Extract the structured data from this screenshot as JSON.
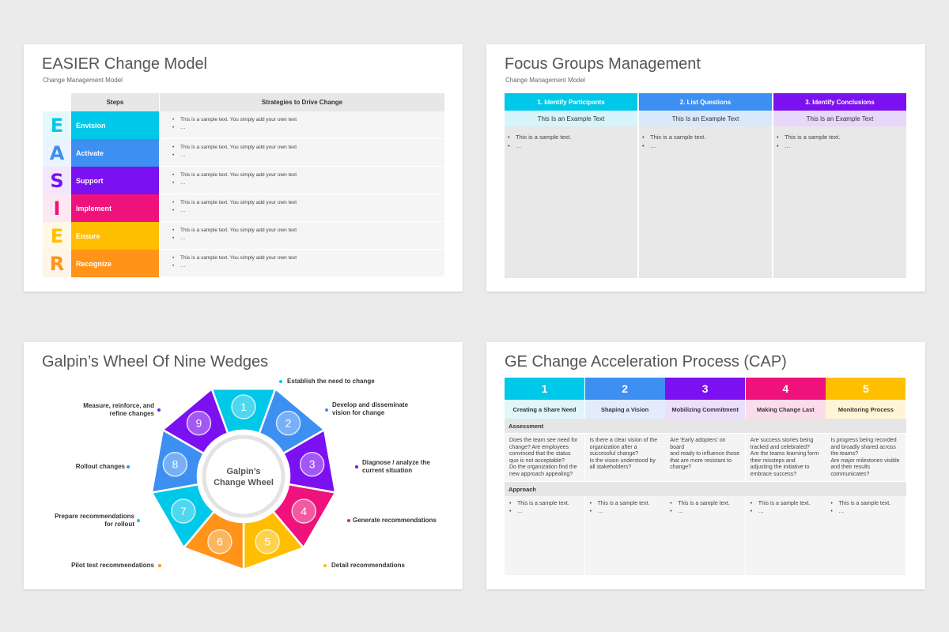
{
  "easier": {
    "title": "EASIER Change Model",
    "subtitle": "Change Management Model",
    "headers": [
      "Steps",
      "Strategies to Drive Change"
    ],
    "rows": [
      {
        "letter": "E",
        "step": "Envision",
        "color": "#00c8e8",
        "b1": "This is a sample text. You simply add your own text",
        "b2": "…"
      },
      {
        "letter": "A",
        "step": "Activate",
        "color": "#3d8ff2",
        "b1": "This is a sample text. You simply add your own text",
        "b2": "…"
      },
      {
        "letter": "S",
        "step": "Support",
        "color": "#7b10f0",
        "b1": "This is a sample text. You simply add your own text",
        "b2": "…"
      },
      {
        "letter": "I",
        "step": "Implement",
        "color": "#f0127c",
        "b1": "This is a sample text. You simply add your own text",
        "b2": "…"
      },
      {
        "letter": "E",
        "step": "Ensure",
        "color": "#ffbf00",
        "b1": "This is a sample text. You simply add your own text",
        "b2": "…"
      },
      {
        "letter": "R",
        "step": "Recognize",
        "color": "#ff9419",
        "b1": "This is a sample text. You simply add your own text",
        "b2": "…"
      }
    ]
  },
  "focus": {
    "title": "Focus Groups Management",
    "subtitle": "Change Management Model",
    "cols": [
      {
        "head": "1. Identify Participants",
        "sub": "This Is an Example Text",
        "color": "#00c8e8",
        "light": "#d6f4fb",
        "b1": "This is a sample text.",
        "b2": "…"
      },
      {
        "head": "2. List Questions",
        "sub": "This Is an Example Text",
        "color": "#3d8ff2",
        "light": "#dae8fc",
        "b1": "This is a sample text.",
        "b2": "…"
      },
      {
        "head": "3. Identify Conclusions",
        "sub": "This Is an Example Text",
        "color": "#7b10f0",
        "light": "#e8d6fb",
        "b1": "This is a sample text.",
        "b2": "…"
      }
    ]
  },
  "wheel": {
    "title": "Galpin’s Wheel Of Nine Wedges",
    "center_line1": "Galpin’s",
    "center_line2": "Change Wheel",
    "wedges": [
      {
        "n": "1",
        "color": "#00c8e8",
        "label_lines": [
          "Establish the need to change"
        ]
      },
      {
        "n": "2",
        "color": "#3d8ff2",
        "label_lines": [
          "Develop and disseminate",
          "vision for change"
        ]
      },
      {
        "n": "3",
        "color": "#7b10f0",
        "label_lines": [
          "Diagnose / analyze the",
          "current situation"
        ]
      },
      {
        "n": "4",
        "color": "#f0127c",
        "label_lines": [
          "Generate recommendations"
        ]
      },
      {
        "n": "5",
        "color": "#ffbf00",
        "label_lines": [
          "Detail recommendations"
        ]
      },
      {
        "n": "6",
        "color": "#ff9419",
        "label_lines": [
          "Pilot test recommendations"
        ]
      },
      {
        "n": "7",
        "color": "#00c8e8",
        "label_lines": [
          "Prepare recommendations",
          "for rollout"
        ]
      },
      {
        "n": "8",
        "color": "#3d8ff2",
        "label_lines": [
          "Rollout changes"
        ]
      },
      {
        "n": "9",
        "color": "#7b10f0",
        "label_lines": [
          "Measure, reinforce, and",
          "refine changes"
        ]
      }
    ]
  },
  "cap": {
    "title": "GE Change Acceleration Process (CAP)",
    "assessment_label": "Assessment",
    "approach_label": "Approach",
    "cols": [
      {
        "n": "1",
        "name": "Creating a Share Need",
        "color": "#00c8e8",
        "light": "#dff6fb",
        "assessment": [
          "Does the team see need for",
          "change? Are employees",
          "convinced that the status",
          "quo is not acceptable?",
          "Do the organization find the",
          "new approach appealing?"
        ],
        "b1": "This is a sample text.",
        "b2": "…"
      },
      {
        "n": "2",
        "name": "Shaping a Vision",
        "color": "#3d8ff2",
        "light": "#e2ecfc",
        "assessment": [
          "Is there a clear vision of the",
          "organization after a",
          "successful change?",
          "Is the vision understood by",
          "all stakeholders?"
        ],
        "b1": "This is a sample text.",
        "b2": "…"
      },
      {
        "n": "3",
        "name": "Mobilizing Commitment",
        "color": "#7b10f0",
        "light": "#ebdffb",
        "assessment": [
          "Are 'Early adopters' on board",
          "and ready to influence those",
          "that are more resistant to",
          "change?"
        ],
        "b1": "This is a sample text.",
        "b2": "…"
      },
      {
        "n": "4",
        "name": "Making Change Last",
        "color": "#f0127c",
        "light": "#fcdcec",
        "assessment": [
          "Are success stories being",
          "tracked and celebrated?",
          "Are the teams learning form",
          "their  missteps and",
          "adjusting the initiative to",
          "embrace success?"
        ],
        "b1": "This is a sample text.",
        "b2": "…"
      },
      {
        "n": "5",
        "name": "Monitoring Process",
        "color": "#ffbf00",
        "light": "#fff5d6",
        "assessment": [
          "Is progress being recorded",
          "and broadly shared across",
          "the teams?",
          "Are major milestones visible",
          "and their results",
          "communicates?"
        ],
        "b1": "This is a sample text.",
        "b2": "…"
      }
    ]
  }
}
